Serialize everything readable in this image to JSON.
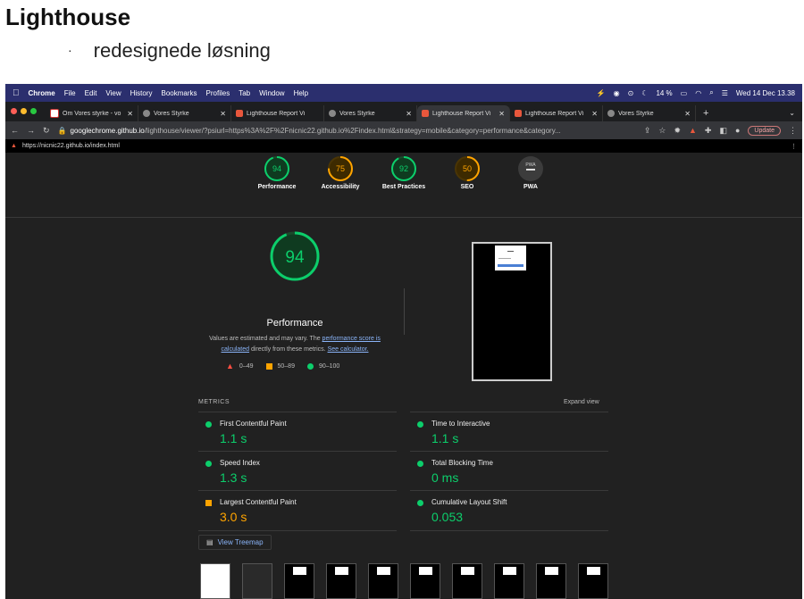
{
  "slide": {
    "title": "Lighthouse",
    "bullet_marker": "·",
    "bullet": "redesignede løsning"
  },
  "menubar": {
    "app": "Chrome",
    "items": [
      "File",
      "Edit",
      "View",
      "History",
      "Bookmarks",
      "Profiles",
      "Tab",
      "Window",
      "Help"
    ],
    "battery": "14 %",
    "datetime": "Wed 14 Dec  13.38"
  },
  "tabs": [
    {
      "label": "Om Vores styrke - vo",
      "icon": "gmail-icon",
      "active": false
    },
    {
      "label": "Vores Styrke",
      "icon": "globe-icon",
      "active": false
    },
    {
      "label": "Lighthouse Report Vi",
      "icon": "lighthouse-icon",
      "active": false
    },
    {
      "label": "Vores Styrke",
      "icon": "globe-icon",
      "active": false
    },
    {
      "label": "Lighthouse Report Vi",
      "icon": "lighthouse-icon",
      "active": true
    },
    {
      "label": "Lighthouse Report Vi",
      "icon": "lighthouse-icon",
      "active": false
    },
    {
      "label": "Vores Styrke",
      "icon": "globe-icon",
      "active": false
    }
  ],
  "address": {
    "host": "googlechrome.github.io",
    "rest": "/lighthouse/viewer/?psiurl=https%3A%2F%2Fnicnic22.github.io%2Findex.html&strategy=mobile&category=performance&category...",
    "update": "Update"
  },
  "site_url": "https://nicnic22.github.io/index.html",
  "colors": {
    "good": "#0cce6b",
    "average": "#ffa400",
    "poor": "#ff4e42"
  },
  "gauges": [
    {
      "label": "Performance",
      "score": "94",
      "value": 94,
      "color": "#0cce6b"
    },
    {
      "label": "Accessibility",
      "score": "75",
      "value": 75,
      "color": "#ffa400"
    },
    {
      "label": "Best Practices",
      "score": "92",
      "value": 92,
      "color": "#0cce6b"
    },
    {
      "label": "SEO",
      "score": "50",
      "value": 50,
      "color": "#ffa400"
    },
    {
      "label": "PWA",
      "score": "PWA",
      "value": 0,
      "color": "#9e9e9e"
    }
  ],
  "performance": {
    "score": "94",
    "value": 94,
    "title": "Performance",
    "desc_pre": "Values are estimated and may vary. The ",
    "desc_link1": "performance score is calculated",
    "desc_mid": " directly from these metrics. ",
    "desc_link2": "See calculator.",
    "legend": [
      "0–49",
      "50–89",
      "90–100"
    ]
  },
  "metrics": {
    "title": "METRICS",
    "expand": "Expand view",
    "items": [
      {
        "name": "First Contentful Paint",
        "value": "1.1 s",
        "status": "good"
      },
      {
        "name": "Time to Interactive",
        "value": "1.1 s",
        "status": "good"
      },
      {
        "name": "Speed Index",
        "value": "1.3 s",
        "status": "good"
      },
      {
        "name": "Total Blocking Time",
        "value": "0 ms",
        "status": "good"
      },
      {
        "name": "Largest Contentful Paint",
        "value": "3.0 s",
        "status": "average"
      },
      {
        "name": "Cumulative Layout Shift",
        "value": "0.053",
        "status": "good"
      }
    ]
  },
  "treemap_label": "View Treemap"
}
